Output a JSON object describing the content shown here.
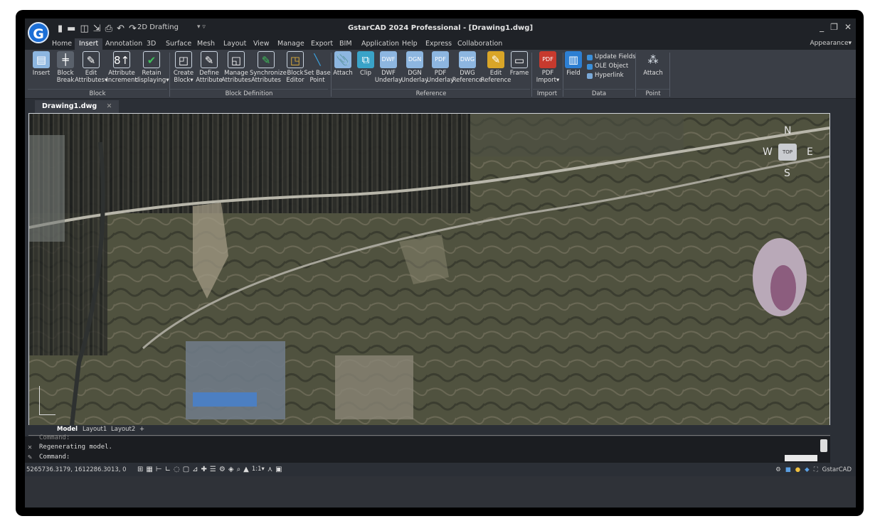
{
  "titlebar": {
    "logo_letter": "G",
    "workspace": "2D Drafting",
    "app_title": "GstarCAD 2024 Professional - [Drawing1.dwg]",
    "min": "_",
    "restore": "❐",
    "close": "✕"
  },
  "menu_tabs": [
    "Home",
    "Insert",
    "Annotation",
    "3D",
    "Surface",
    "Mesh",
    "Layout",
    "View",
    "Manage",
    "Export",
    "BIM",
    "Application",
    "Help",
    "Express",
    "Collaboration"
  ],
  "active_tab": "Insert",
  "appearance": "Appearance▾",
  "ribbon": {
    "insert": "Insert",
    "block_break_1": "Block",
    "block_break_2": "Break",
    "edit_attr_1": "Edit",
    "edit_attr_2": "Attributes▾",
    "attr_inc_1": "Attribute",
    "attr_inc_2": "Increment",
    "retain_1": "Retain",
    "retain_2": "displaying▾",
    "create_1": "Create",
    "create_2": "Block▾",
    "define_1": "Define",
    "define_2": "Attribute",
    "manage_1": "Manage",
    "manage_2": "Attributes",
    "sync_1": "Synchronize",
    "sync_2": "Attributes",
    "beditor_1": "Block",
    "beditor_2": "Editor",
    "setbase_1": "Set Base",
    "setbase_2": "Point",
    "attach": "Attach",
    "clip": "Clip",
    "dwf_1": "DWF",
    "dwf_2": "Underlay",
    "dgn_1": "DGN",
    "dgn_2": "Underlay",
    "pdf_1": "PDF",
    "pdf_2": "Underlay",
    "dwg_1": "DWG",
    "dwg_2": "Reference",
    "editref_1": "Edit",
    "editref_2": "Reference",
    "frame": "Frame",
    "pdfimp_1": "PDF",
    "pdfimp_2": "Import▾",
    "field": "Field",
    "update_fields": "Update Fields",
    "ole_object": "OLE Object",
    "hyperlink": "Hyperlink",
    "pc_attach": "Attach",
    "groups": {
      "block": "Block",
      "block_def": "Block Definition",
      "reference": "Reference",
      "import": "Import",
      "data": "Data",
      "point_cloud": "Point Cloud"
    }
  },
  "document": {
    "tab": "Drawing1.dwg",
    "close": "✕"
  },
  "navcube": {
    "n": "N",
    "s": "S",
    "e": "E",
    "w": "W",
    "top": "TOP"
  },
  "layout_tabs": {
    "model": "Model",
    "layout1": "Layout1",
    "layout2": "Layout2",
    "add": "+"
  },
  "command": {
    "history_1": "Command:",
    "history_2": "Regenerating model.",
    "prompt": "Command:"
  },
  "status": {
    "coords": "5265736.3179, 1612286.3013, 0",
    "scale": "1:1▾",
    "brand": "GstarCAD"
  },
  "colors": {
    "accent": "#2d7fd3",
    "ribbon_bg": "#3a3e46",
    "title_bg": "#1f2227"
  }
}
